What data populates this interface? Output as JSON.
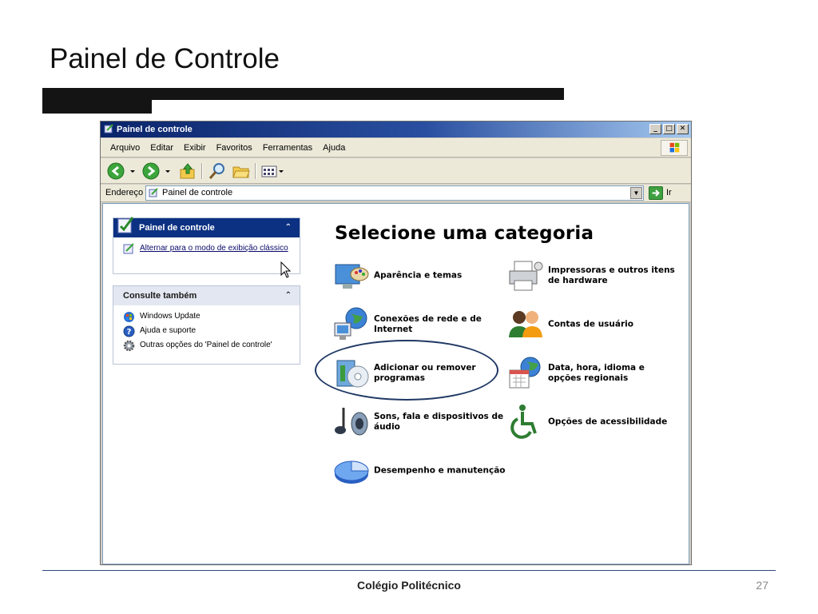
{
  "slide": {
    "title": "Painel de Controle",
    "footer": "Colégio Politécnico",
    "page_number": "27"
  },
  "window": {
    "title": "Painel de control​e",
    "controls": {
      "minimize": "_",
      "maximize": "□",
      "close": "✕"
    },
    "menu": [
      "Arquivo",
      "Editar",
      "Exibir",
      "Favoritos",
      "Ferramentas",
      "Ajuda"
    ],
    "address": {
      "label": "Endereço",
      "value": "Painel de controle",
      "go_label": "Ir"
    },
    "icons": {
      "toolbar": [
        "back-arrow-icon",
        "forward-arrow-icon",
        "up-folder-icon",
        "search-icon",
        "folders-icon",
        "views-icon"
      ]
    }
  },
  "sidebar": {
    "control_panel": {
      "title": "Painel de controle",
      "task": "Alternar para o modo de exibição clássico"
    },
    "see_also": {
      "title": "Consulte também",
      "items": [
        "Windows Update",
        "Ajuda e suporte",
        "Outras opções do 'Painel de controle'"
      ]
    }
  },
  "main": {
    "heading": "Selecione uma categoria",
    "categories": [
      {
        "label": "Aparência e temas",
        "icon": "appearance-icon"
      },
      {
        "label": "Impressoras e outros itens de hardware",
        "icon": "printer-icon"
      },
      {
        "label": "Conexões de rede e de Internet",
        "icon": "network-icon"
      },
      {
        "label": "Contas de usuário",
        "icon": "users-icon"
      },
      {
        "label": "Adicionar ou remover programas",
        "icon": "cd-box-icon"
      },
      {
        "label": "Data, hora, idioma e opções regionais",
        "icon": "calendar-globe-icon"
      },
      {
        "label": "Sons, fala e dispositivos de áudio",
        "icon": "music-note-icon"
      },
      {
        "label": "Opções de acessibilidade",
        "icon": "wheelchair-icon"
      },
      {
        "label": "Desempenho e manutenção",
        "icon": "pie-chart-icon"
      }
    ]
  },
  "colors": {
    "title_bar": "#0a246a",
    "task_header": "#0c3182",
    "highlight": "#1f3864",
    "slide_bar": "#141414"
  }
}
